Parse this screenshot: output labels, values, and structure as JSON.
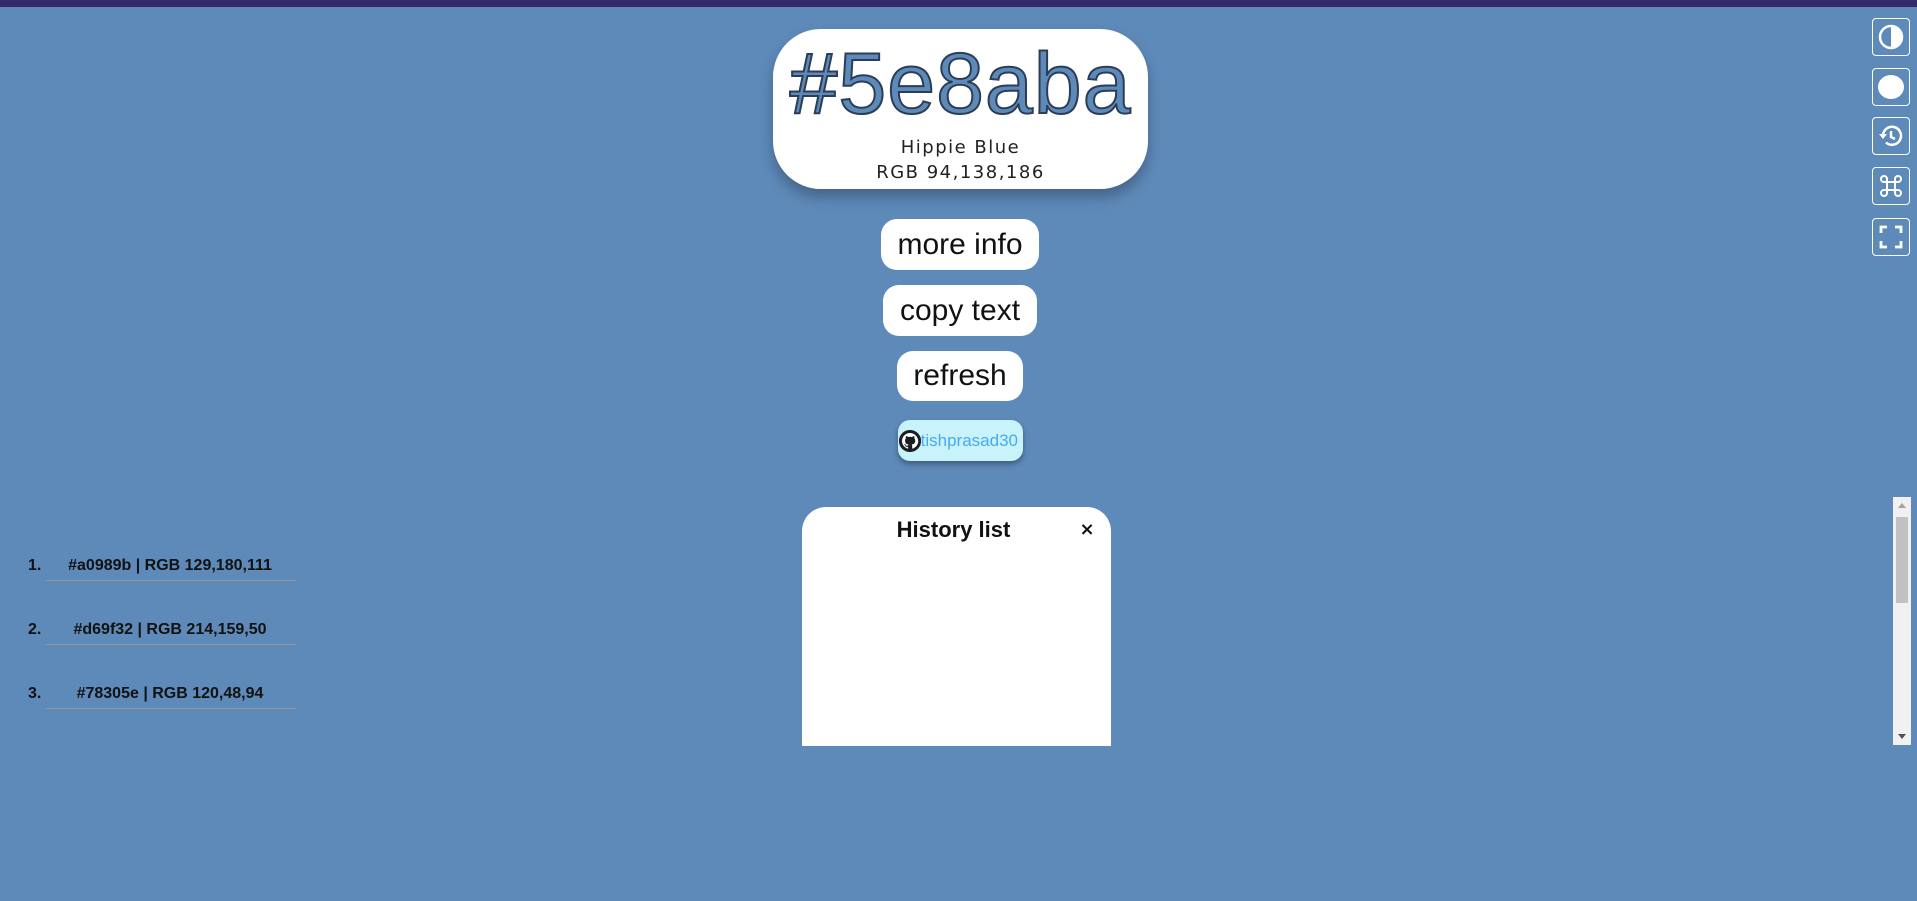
{
  "colors": {
    "background": "#5e8aba",
    "topbar": "#33296b"
  },
  "color_card": {
    "hex": "#5e8aba",
    "name": "Hippie Blue",
    "rgb": "RGB 94,138,186"
  },
  "buttons": {
    "more_info": "more info",
    "copy_text": "copy text",
    "refresh": "refresh"
  },
  "github": {
    "icon": "github-icon",
    "label": "atishprasad30"
  },
  "history": {
    "title": "History list",
    "close_label": "×",
    "items": [
      {
        "num": "1.",
        "text": "#a0989b | RGB 129,180,111"
      },
      {
        "num": "2.",
        "text": "#d69f32 | RGB 214,159,50"
      },
      {
        "num": "3.",
        "text": "#78305e | RGB 120,48,94"
      }
    ]
  },
  "toolbar": {
    "icons": [
      "contrast-icon",
      "circle-icon",
      "history-icon",
      "command-icon",
      "fullscreen-icon"
    ]
  }
}
